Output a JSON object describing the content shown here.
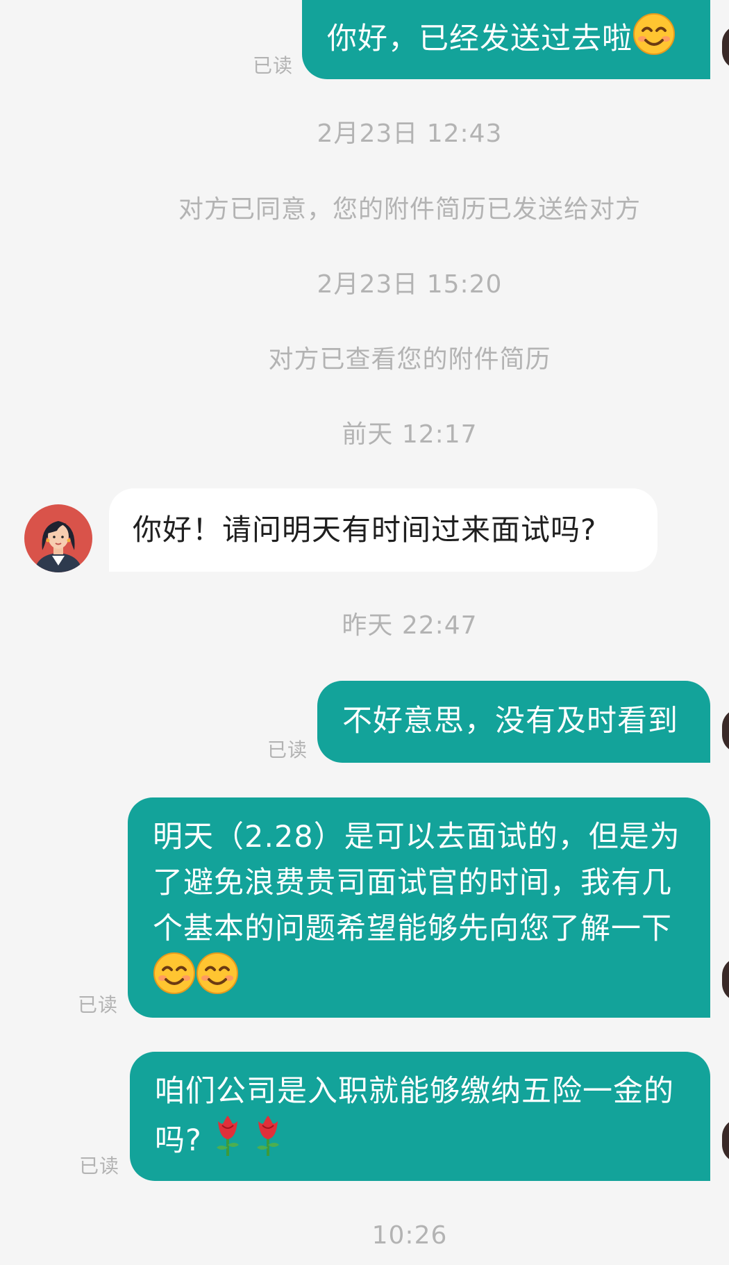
{
  "chat": {
    "messages": {
      "m1": {
        "text": "你好，已经发送过去啦",
        "emoji": "smiling-face-emoji",
        "status": "已读"
      },
      "m2": {
        "text": "你好！请问明天有时间过来面试吗?"
      },
      "m3": {
        "text": "不好意思，没有及时看到",
        "status": "已读"
      },
      "m4": {
        "line1": "明天（2.28）是可以去面试的，但是为",
        "line2": "了避免浪费贵司面试官的时间，我有几",
        "line3": "个基本的问题希望能够先向您了解一下",
        "emoji": "smiling-face-emoji",
        "status": "已读"
      },
      "m5": {
        "line1": "咱们公司是入职就能够缴纳五险一金的",
        "line2": "吗?",
        "emoji": "rose-emoji",
        "status": "已读"
      }
    },
    "timestamps": {
      "t1": "2月23日 12:43",
      "t2": "2月23日 15:20",
      "t3": "前天 12:17",
      "t4": "昨天 22:47",
      "t5": "10:26"
    },
    "system": {
      "s1": "对方已同意，您的附件简历已发送给对方",
      "s2": "对方已查看您的附件简历"
    }
  },
  "colors": {
    "background": "#f5f5f5",
    "outgoing_bubble": "#13a39a",
    "incoming_bubble": "#ffffff",
    "meta_text": "#b3b3b3",
    "avatar_ring": "#d9534a"
  },
  "icons": {
    "recruiter_avatar": "woman-avatar-icon",
    "self_avatar": "user-avatar-icon"
  }
}
